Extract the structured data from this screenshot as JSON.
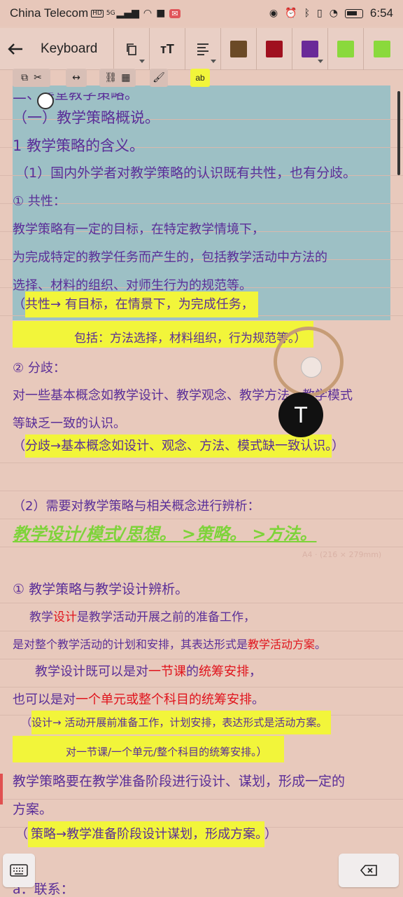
{
  "status": {
    "carrier": "China Telecom",
    "hd": "HD",
    "network": "5G",
    "time": "6:54"
  },
  "toolbar": {
    "title": "Keyboard",
    "swatches": [
      "#6b4a26",
      "#a0101f",
      "#6a2a98",
      "#8ad93c",
      "#8ad93c"
    ]
  },
  "minitools": {
    "highlight_label": "ab"
  },
  "doc": {
    "l1": "二、课堂教学策略。",
    "l2": "（一）教学策略概说。",
    "l3": "1  教学策略的含义。",
    "l4": "（1）国内外学者对教学策略的认识既有共性，也有分歧。",
    "l5": "①  共性：",
    "l6": "教学策略有一定的目标，在特定教学情境下，",
    "l7": "为完成特定的教学任务而产生的，包括教学活动中方法的",
    "l8": "选择、材料的组织、对师生行为的规范等。",
    "l9_open": "（",
    "l9": "共性→ 有目标，在情景下，为完成任务，",
    "l10": "包括：方法选择，材料组织，行为规范等。",
    "l10_close": "）",
    "l11": "②  分歧：",
    "l12": "对一些基本概念如教学设计、教学观念、教学方法、教学模式",
    "l13": "等缺乏一致的认识。",
    "l14_open": "（",
    "l14": "分歧→基本概念如设计、观念、方法、模式缺一致认识。",
    "l14_close": "）",
    "l15": "（2）需要对教学策略与相关概念进行辨析：",
    "l16": "教学设计/模式/思想。  >策略。  >方法。",
    "l16_meta": "A4 · (216 × 279mm)",
    "l17": "①  教学策略与教学设计辨析。",
    "l18a": "教学",
    "l18b": "设计",
    "l18c": "是教学活动开展之前的准备工作，",
    "l19a": "是对整个教学活动的计划和安排，其表达形式是",
    "l19b": "教学活动方案",
    "l19c": "。",
    "l20a": "教学设计既可以是对",
    "l20b": "一节课",
    "l20c": "的",
    "l20d": "统筹安排",
    "l20e": "，",
    "l21a": "也可以是对",
    "l21b": "一个单元或整个科目的统筹安排",
    "l21c": "。",
    "l22_open": "（",
    "l22": "设计→ 活动开展前准备工作，计划安排，表达形式是活动方案。",
    "l23": "对一节课/一个单元/整个科目的统筹安排。",
    "l23_close": "）",
    "l24": "教学策略要在教学准备阶段进行设计、谋划，形成一定的",
    "l25": "方案。",
    "l26_open": "（",
    "l26": "策略→教学准备阶段设计谋划，形成方案。",
    "l26_close": "）",
    "l27": "a．联系："
  },
  "overlay": {
    "t_bubble": "T"
  },
  "keyboard": {
    "keyboard_icon": "keyboard-icon",
    "backspace_icon": "backspace-icon"
  }
}
